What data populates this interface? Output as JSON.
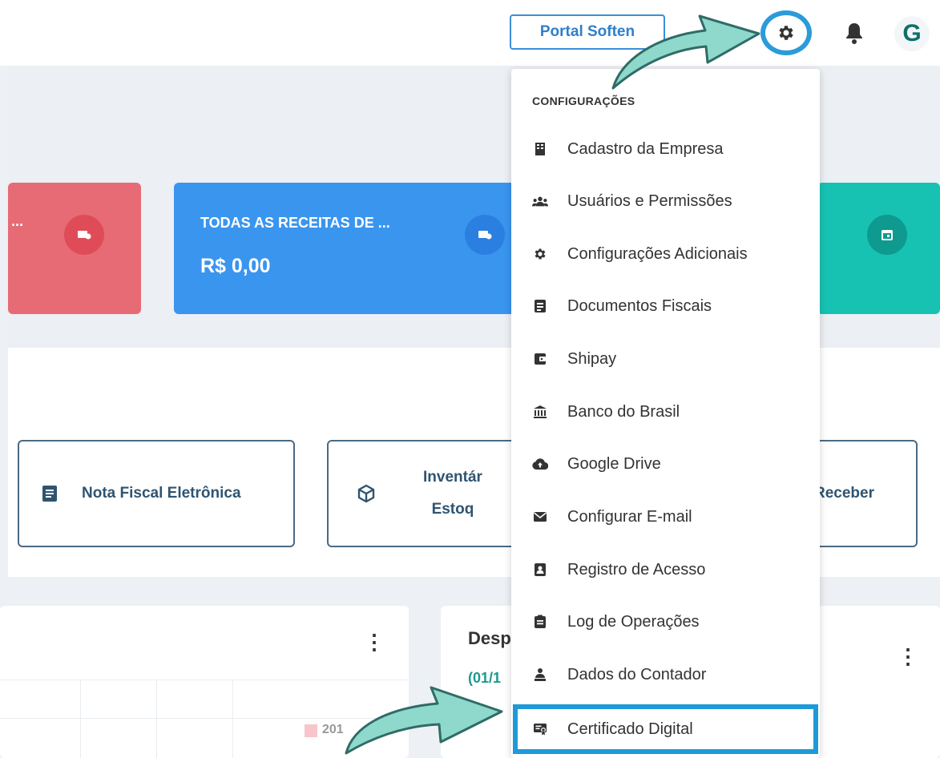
{
  "header": {
    "portal_button": "Portal Soften",
    "avatar_letter": "G"
  },
  "cards": {
    "red_label": "...",
    "blue_title": "TODAS AS RECEITAS DE ...",
    "blue_value": "R$ 0,00"
  },
  "quick_actions": {
    "nota_fiscal": "Nota Fiscal Eletrônica",
    "inventario_1": "Inventár",
    "inventario_2": "Estoq",
    "receber": "Receber"
  },
  "panels": {
    "right_title": "Desp",
    "right_subtitle": "(01/1",
    "legend_partial": "201"
  },
  "menu": {
    "header": "CONFIGURAÇÕES",
    "items": [
      {
        "label": "Cadastro da Empresa",
        "icon": "building-icon"
      },
      {
        "label": "Usuários e Permissões",
        "icon": "users-icon"
      },
      {
        "label": "Configurações Adicionais",
        "icon": "gear-icon"
      },
      {
        "label": "Documentos Fiscais",
        "icon": "document-icon"
      },
      {
        "label": "Shipay",
        "icon": "wallet-icon"
      },
      {
        "label": "Banco do Brasil",
        "icon": "bank-icon"
      },
      {
        "label": "Google Drive",
        "icon": "cloud-upload-icon"
      },
      {
        "label": "Configurar E-mail",
        "icon": "envelope-icon"
      },
      {
        "label": "Registro de Acesso",
        "icon": "id-badge-icon"
      },
      {
        "label": "Log de Operações",
        "icon": "clipboard-icon"
      },
      {
        "label": "Dados do Contador",
        "icon": "accountant-icon"
      },
      {
        "label": "Certificado Digital",
        "icon": "certificate-icon"
      }
    ]
  },
  "colors": {
    "highlight": "#1e9ad8",
    "card_red": "#e66b75",
    "card_blue": "#3a95ef",
    "card_teal": "#17c2b3",
    "arrow": "#8fd8cc"
  }
}
